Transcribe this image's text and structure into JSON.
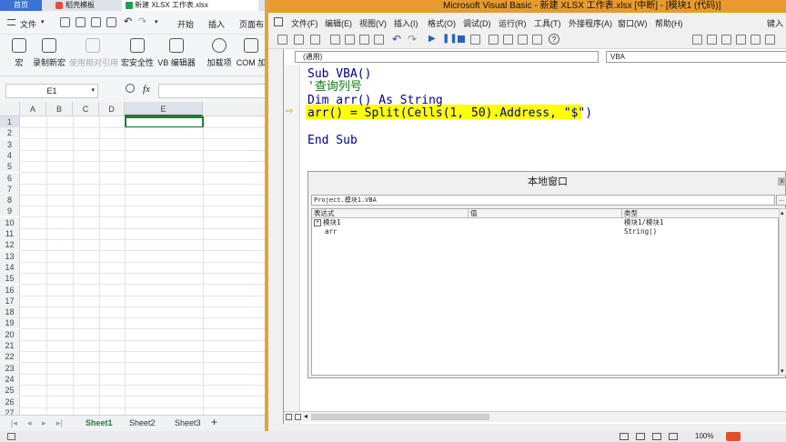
{
  "wps": {
    "tabs": [
      "首页",
      "稻壳模板",
      "新建 XLSX 工作表.xlsx"
    ],
    "menu": [
      "文件",
      "开始",
      "插入",
      "页面布"
    ],
    "ribbon": [
      {
        "label": "宏",
        "icon": "macro-icon"
      },
      {
        "label": "录制新宏",
        "icon": "record-macro-icon"
      },
      {
        "label": "使用相对引用",
        "icon": "relative-ref-icon"
      },
      {
        "label": "宏安全性",
        "icon": "macro-security-icon"
      },
      {
        "label": "VB 编辑器",
        "icon": "vb-editor-icon"
      },
      {
        "label": "加载项",
        "icon": "addins-icon"
      },
      {
        "label": "COM 加",
        "icon": "com-addins-icon"
      }
    ],
    "namebox": "E1",
    "fx": "fx",
    "columns": [
      "A",
      "B",
      "C",
      "D",
      "E"
    ],
    "rows": [
      "1",
      "2",
      "3",
      "4",
      "5",
      "6",
      "7",
      "8",
      "9",
      "10",
      "11",
      "12",
      "13",
      "14",
      "15",
      "16",
      "17",
      "18",
      "19",
      "20",
      "21",
      "22",
      "23",
      "24",
      "25",
      "26",
      "27"
    ],
    "sheets": [
      "Sheet1",
      "Sheet2",
      "Sheet3"
    ],
    "add_sheet": "+",
    "zoom": "100%"
  },
  "vbe": {
    "title": "Microsoft Visual Basic - 新建 XLSX 工作表.xlsx [中断] - [模块1 (代码)]",
    "menu": [
      "文件(F)",
      "编辑(E)",
      "视图(V)",
      "插入(I)",
      "格式(O)",
      "调试(D)",
      "运行(R)",
      "工具(T)",
      "外接程序(A)",
      "窗口(W)",
      "帮助(H)"
    ],
    "help_hint": "键入",
    "object_combo": "(通用)",
    "proc_combo": "VBA",
    "code": {
      "line1_kw": "Sub",
      "line1_rest": " VBA()",
      "line2": "'查询列号",
      "line3_kw1": "Dim",
      "line3_mid": " arr() ",
      "line3_kw2": "As String",
      "line4": "arr() = Split(Cells(1, 50).Address, \"$\")",
      "line5": "End Sub"
    },
    "locals": {
      "title": "本地窗口",
      "close": "x",
      "context": "Project.模块1.VBA",
      "context_button": "...",
      "headers": [
        "表达式",
        "值",
        "类型"
      ],
      "rows": [
        {
          "expand": "+",
          "expr": "模块1",
          "value": "",
          "type": "模块1/模块1"
        },
        {
          "expand": "",
          "expr": "arr",
          "value": "",
          "type": "String()"
        }
      ]
    }
  }
}
